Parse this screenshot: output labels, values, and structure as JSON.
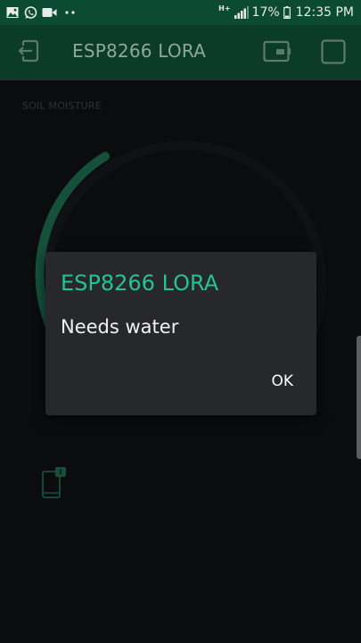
{
  "status_bar": {
    "battery_percent": "17%",
    "time": "12:35 PM",
    "network_type": "H+",
    "left_icons": [
      "gallery-icon",
      "whatsapp-icon",
      "video-icon",
      "more-dots-icon"
    ]
  },
  "app_bar": {
    "title": "ESP8266 LORA"
  },
  "dashboard": {
    "gauge": {
      "label": "SOIL MOISTURE",
      "accent_color": "#1d6b4f",
      "track_color": "#15181b"
    }
  },
  "dialog": {
    "title": "ESP8266 LORA",
    "message": "Needs water",
    "ok_label": "OK",
    "title_color": "#24c48e"
  },
  "colors": {
    "status_bar": "#0b4a33",
    "toolbar": "#0b3b29",
    "background": "#0e1013",
    "accent": "#24c48e"
  }
}
